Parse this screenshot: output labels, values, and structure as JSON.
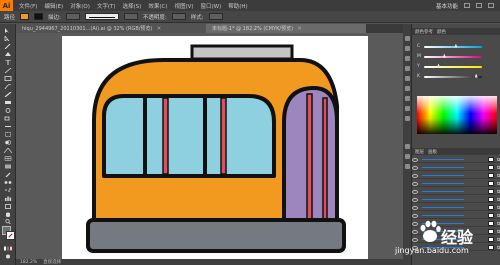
{
  "app": {
    "logo": "Ai",
    "menus": [
      "文件(F)",
      "编辑(E)",
      "对象(O)",
      "文字(T)",
      "选择(S)",
      "效果(C)",
      "视图(V)",
      "窗口(W)",
      "帮助(H)"
    ],
    "workspace": "基本功能"
  },
  "controlbar": {
    "left_label": "路径",
    "stroke_label": "描边:",
    "opacity_label": "不透明度:",
    "style_label": "样式:"
  },
  "document": {
    "tab_label": "hiqu_2944967_20110301...(Ai).ai @ 32% (RGB/预览)",
    "artboard_tab_label": "未标题-1* @ 182.2% (CMYK/预览)"
  },
  "panels": {
    "color_tabs": [
      "颜色参考",
      "颜色"
    ],
    "sliders": [
      {
        "label": "C",
        "value": 0.55,
        "color": "#00a3e0"
      },
      {
        "label": "M",
        "value": 0.35,
        "color": "#e3007f"
      },
      {
        "label": "Y",
        "value": 0.25,
        "color": "#ffe600"
      },
      {
        "label": "K",
        "value": 0.9,
        "color": "#222222"
      }
    ],
    "layers_tabs": [
      "图层",
      "画板"
    ],
    "layer_rows": 12
  },
  "status": {
    "zoom": "182.2%",
    "tool": "直接选择"
  },
  "colors": {
    "bus_body": "#f29a1f",
    "window": "#8ecfe0",
    "stripe_red": "#e0505a",
    "door_purple": "#9d85bd",
    "bumper": "#757a80",
    "roof_rack": "#c4c4c4",
    "outline": "#111111"
  },
  "watermark": {
    "brand": "经验",
    "url": "jingyan.baidu.com"
  }
}
